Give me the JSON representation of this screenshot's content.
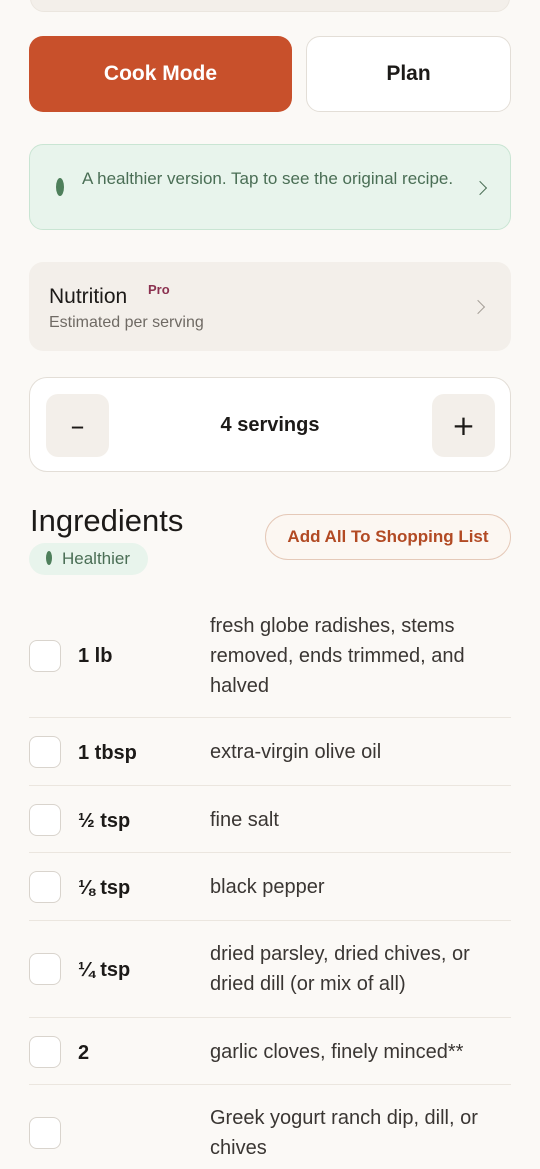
{
  "actions": {
    "cook_mode_label": "Cook Mode",
    "plan_label": "Plan"
  },
  "banner": {
    "text": "A healthier version. Tap to see the original recipe."
  },
  "nutrition": {
    "title": "Nutrition",
    "badge": "Pro",
    "subtitle": "Estimated per serving"
  },
  "servings": {
    "minus_label": "–",
    "plus_label": "+",
    "label": "4 servings"
  },
  "ingredients": {
    "title": "Ingredients",
    "badge": "Healthier",
    "add_all_label": "Add All To Shopping List",
    "items": [
      {
        "qty": "1 lb",
        "desc": "fresh globe radishes, stems removed, ends trimmed, and halved"
      },
      {
        "qty": "1 tbsp",
        "desc": "extra-virgin olive oil"
      },
      {
        "qty": "½ tsp",
        "desc": "fine salt"
      },
      {
        "qty": "⅛ tsp",
        "desc": "black pepper"
      },
      {
        "qty": "¼ tsp",
        "desc": "dried parsley, dried chives, or dried dill (or mix of all)"
      },
      {
        "qty": "2",
        "desc": "garlic cloves, finely minced**"
      },
      {
        "qty": "",
        "desc": "Greek yogurt ranch dip, dill, or chives"
      }
    ]
  },
  "colors": {
    "accent": "#c8502b",
    "healthy_green": "#4a6e55",
    "pro_badge": "#8b3150"
  }
}
